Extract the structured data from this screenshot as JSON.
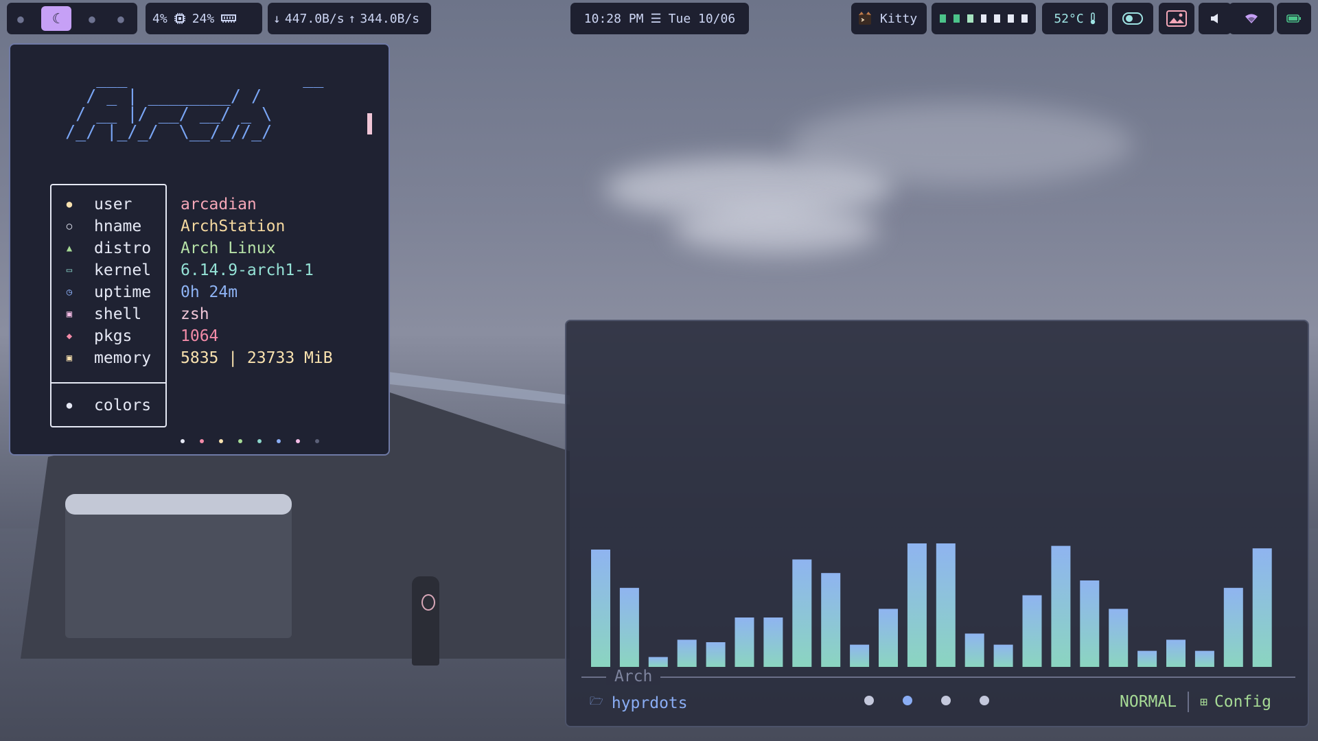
{
  "bar": {
    "workspaces": [
      {
        "icon": "ghost-icon",
        "active": false
      },
      {
        "icon": "moon-icon",
        "active": true
      },
      {
        "icon": "ghost-icon",
        "active": false
      },
      {
        "icon": "ghost-icon",
        "active": false
      }
    ],
    "cpu": "4%",
    "ram": "24%",
    "download": "447.0B/s",
    "upload": "344.0B/s",
    "time": "10:28 PM",
    "date": "Tue 10/06",
    "active_window": "Kitty",
    "temperature": "52°C",
    "colors": {
      "accent": "#c6a0f6",
      "bg": "#1e2030",
      "green": "#4cc38a",
      "battery": "#4cc38a"
    }
  },
  "fetch": {
    "ascii_logo": "     ___                 __\n    / _ | ________/ /\n   / __ |/ __/ __/ _ \\\n  /_/ |_/_/  \\__/_//_/",
    "rows": [
      {
        "icon": "user-icon",
        "key": "user",
        "value": "arcadian",
        "color": "#f5a7b8"
      },
      {
        "icon": "circle-icon",
        "key": "hname",
        "value": "ArchStation",
        "color": "#f5d9a0"
      },
      {
        "icon": "penguin-icon",
        "key": "distro",
        "value": "Arch Linux",
        "color": "#b7e3a8"
      },
      {
        "icon": "laptop-icon",
        "key": "kernel",
        "value": "6.14.9-arch1-1",
        "color": "#95e2d6"
      },
      {
        "icon": "clock-icon",
        "key": "uptime",
        "value": "0h 24m",
        "color": "#8fb4f5"
      },
      {
        "icon": "terminal-icon",
        "key": "shell",
        "value": "zsh",
        "color": "#f0c6d7"
      },
      {
        "icon": "package-icon",
        "key": "pkgs",
        "value": "1064",
        "color": "#f38ba8"
      },
      {
        "icon": "chip-icon",
        "key": "memory",
        "value": "5835 | 23733 MiB",
        "color": "#f9e2af"
      }
    ],
    "colors_label": "colors",
    "palette": [
      "#e6e9f5",
      "#f38ba8",
      "#f9e2af",
      "#a6da95",
      "#8bd5ca",
      "#8aadf4",
      "#f5bde6",
      "#5b6078"
    ]
  },
  "cava": {
    "tab_label": "Arch",
    "folder": "hyprdots",
    "mode": "NORMAL",
    "config_label": "Config",
    "page_dots": [
      "#c4c8dc",
      "#8aadf4",
      "#c4c8dc",
      "#c4c8dc"
    ],
    "levels": [
      0.95,
      0.64,
      0.08,
      0.22,
      0.2,
      0.4,
      0.4,
      0.87,
      0.76,
      0.18,
      0.47,
      1.0,
      1.0,
      0.27,
      0.18,
      0.58,
      0.98,
      0.7,
      0.47,
      0.13,
      0.22,
      0.13,
      0.64,
      0.96
    ]
  }
}
